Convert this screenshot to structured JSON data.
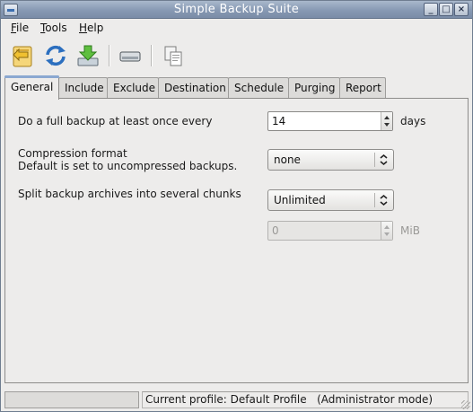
{
  "window": {
    "title": "Simple Backup Suite",
    "controls": [
      "minimize",
      "maximize",
      "close"
    ]
  },
  "menu": {
    "file": "File",
    "tools": "Tools",
    "help": "Help"
  },
  "toolbar": {
    "buttons": [
      "open-profile-icon",
      "refresh-icon",
      "download-icon",
      "drive-icon",
      "copy-icon"
    ]
  },
  "tabs": [
    {
      "label": "General",
      "active": true
    },
    {
      "label": "Include",
      "active": false
    },
    {
      "label": "Exclude",
      "active": false
    },
    {
      "label": "Destination",
      "active": false
    },
    {
      "label": "Schedule",
      "active": false
    },
    {
      "label": "Purging",
      "active": false
    },
    {
      "label": "Report",
      "active": false
    }
  ],
  "general": {
    "full_backup_label": "Do a full backup at least once every",
    "full_backup_value": "14",
    "full_backup_unit": "days",
    "compression_label": "Compression format",
    "compression_hint": "Default is set to uncompressed backups.",
    "compression_value": "none",
    "split_label": "Split backup archives into several chunks",
    "split_value": "Unlimited",
    "chunk_size_value": "0",
    "chunk_size_unit": "MiB"
  },
  "status": {
    "profile_text": "Current profile: Default Profile   (Administrator mode)"
  },
  "colors": {
    "titlebar": "#8799b3",
    "window_bg": "#edeceb",
    "accent_tab": "#8ba8d1"
  }
}
